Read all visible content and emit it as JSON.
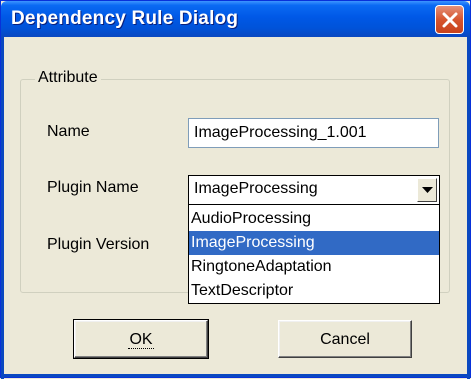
{
  "window": {
    "title": "Dependency Rule Dialog"
  },
  "group": {
    "label": "Attribute"
  },
  "fields": {
    "name_label": "Name",
    "name_value": "ImageProcessing_1.001",
    "plugin_name_label": "Plugin Name",
    "plugin_name_value": "ImageProcessing",
    "plugin_version_label": "Plugin Version"
  },
  "dropdown": {
    "options": [
      "AudioProcessing",
      "ImageProcessing",
      "RingtoneAdaptation",
      "TextDescriptor"
    ],
    "selected": "ImageProcessing"
  },
  "buttons": {
    "ok": "OK",
    "cancel": "Cancel"
  },
  "icons": {
    "close": "close-icon",
    "combo_arrow": "chevron-down-icon"
  },
  "colors": {
    "titlebar": "#0058e6",
    "close_button": "#d6552f",
    "selection": "#316ac5",
    "face": "#ece9d8"
  }
}
